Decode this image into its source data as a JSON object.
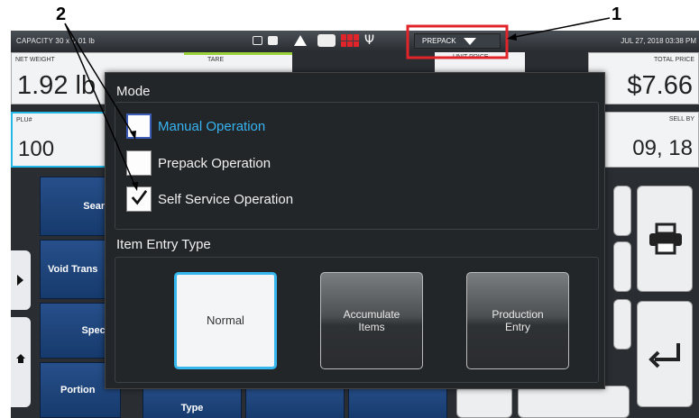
{
  "callouts": {
    "one": "1",
    "two": "2"
  },
  "statusbar": {
    "capacity": "CAPACITY   30 x 0.01 lb",
    "prepack_label": "PREPACK",
    "datetime": "JUL 27, 2018 03:38 PM"
  },
  "readouts": {
    "net_weight_label": "NET WEIGHT",
    "net_weight_value": "1.92 lb",
    "tare_label": "TARE",
    "unit_price_label": "UNIT PRICE",
    "total_price_label": "TOTAL PRICE",
    "total_price_value": "$7.66",
    "plu_label": "PLU#",
    "plu_value": "100",
    "sell_by_label": "SELL BY",
    "sell_by_value": "09, 18"
  },
  "background_keys": [
    "Search",
    "Void Trans",
    "Special",
    "Portion",
    "Type"
  ],
  "colors": {
    "accent": "#36b3f0",
    "highlight_box": "#e0242a",
    "tare_green": "#9bd13a"
  },
  "modal": {
    "mode_title": "Mode",
    "options": [
      {
        "label": "Manual Operation",
        "checked": false,
        "active": true
      },
      {
        "label": "Prepack Operation",
        "checked": false,
        "active": false
      },
      {
        "label": "Self Service Operation",
        "checked": true,
        "active": false
      }
    ],
    "entry_title": "Item Entry Type",
    "entry_buttons": [
      {
        "label": "Normal",
        "selected": true
      },
      {
        "label": "Accumulate Items",
        "line1": "Accumulate",
        "line2": "Items",
        "selected": false
      },
      {
        "label": "Production Entry",
        "line1": "Production",
        "line2": "Entry",
        "selected": false
      }
    ]
  },
  "icons": [
    "battery-icon",
    "warning-icon",
    "printer-icon",
    "grid-icon",
    "usb-icon",
    "dropdown-triangle-icon",
    "printer-key-icon",
    "enter-key-icon",
    "side-arrow-icon",
    "home-icon",
    "checkmark-icon"
  ]
}
